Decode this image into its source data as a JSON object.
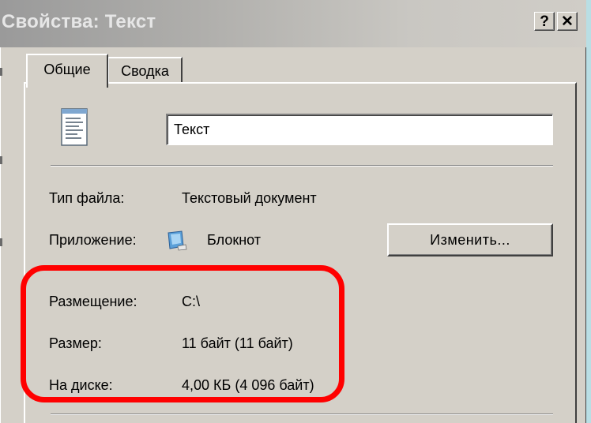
{
  "window": {
    "title": "Свойства: Текст",
    "help_label": "?",
    "close_label": "✕"
  },
  "tabs": [
    {
      "label": "Общие",
      "selected": true
    },
    {
      "label": "Сводка",
      "selected": false
    }
  ],
  "general": {
    "file_icon": "notepad-document-icon",
    "file_name": "Текст",
    "rows": [
      {
        "label": "Тип файла:",
        "value": "Текстовый документ"
      },
      {
        "label": "Приложение:",
        "value": "Блокнот",
        "icon": "notepad-app-icon"
      },
      {
        "label": "Размещение:",
        "value": "C:\\"
      },
      {
        "label": "Размер:",
        "value": "11 байт (11 байт)"
      },
      {
        "label": "На диске:",
        "value": "4,00 КБ (4 096 байт)"
      }
    ],
    "change_button": "Изменить..."
  },
  "highlight_color": "#ff0000"
}
